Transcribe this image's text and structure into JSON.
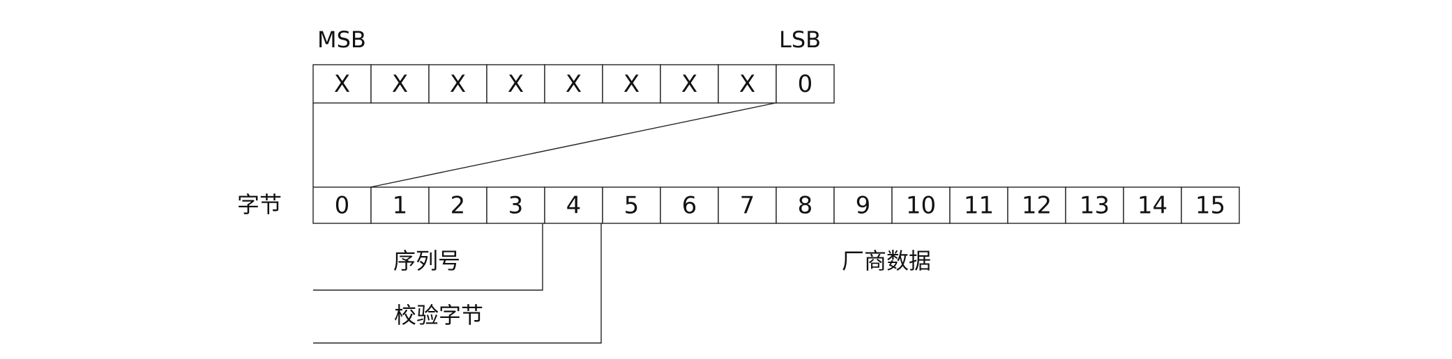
{
  "labels": {
    "msb": "MSB",
    "lsb": "LSB",
    "byte_row": "字节",
    "serial_number": "序列号",
    "checksum_byte": "校验字节",
    "vendor_data": "厂商数据"
  },
  "bit_cells": [
    "X",
    "X",
    "X",
    "X",
    "X",
    "X",
    "X",
    "X",
    "0"
  ],
  "byte_cells": [
    "0",
    "1",
    "2",
    "3",
    "4",
    "5",
    "6",
    "7",
    "8",
    "9",
    "10",
    "11",
    "12",
    "13",
    "14",
    "15"
  ],
  "colors": {
    "line": "#222222",
    "text": "#111111",
    "background": "#ffffff"
  }
}
